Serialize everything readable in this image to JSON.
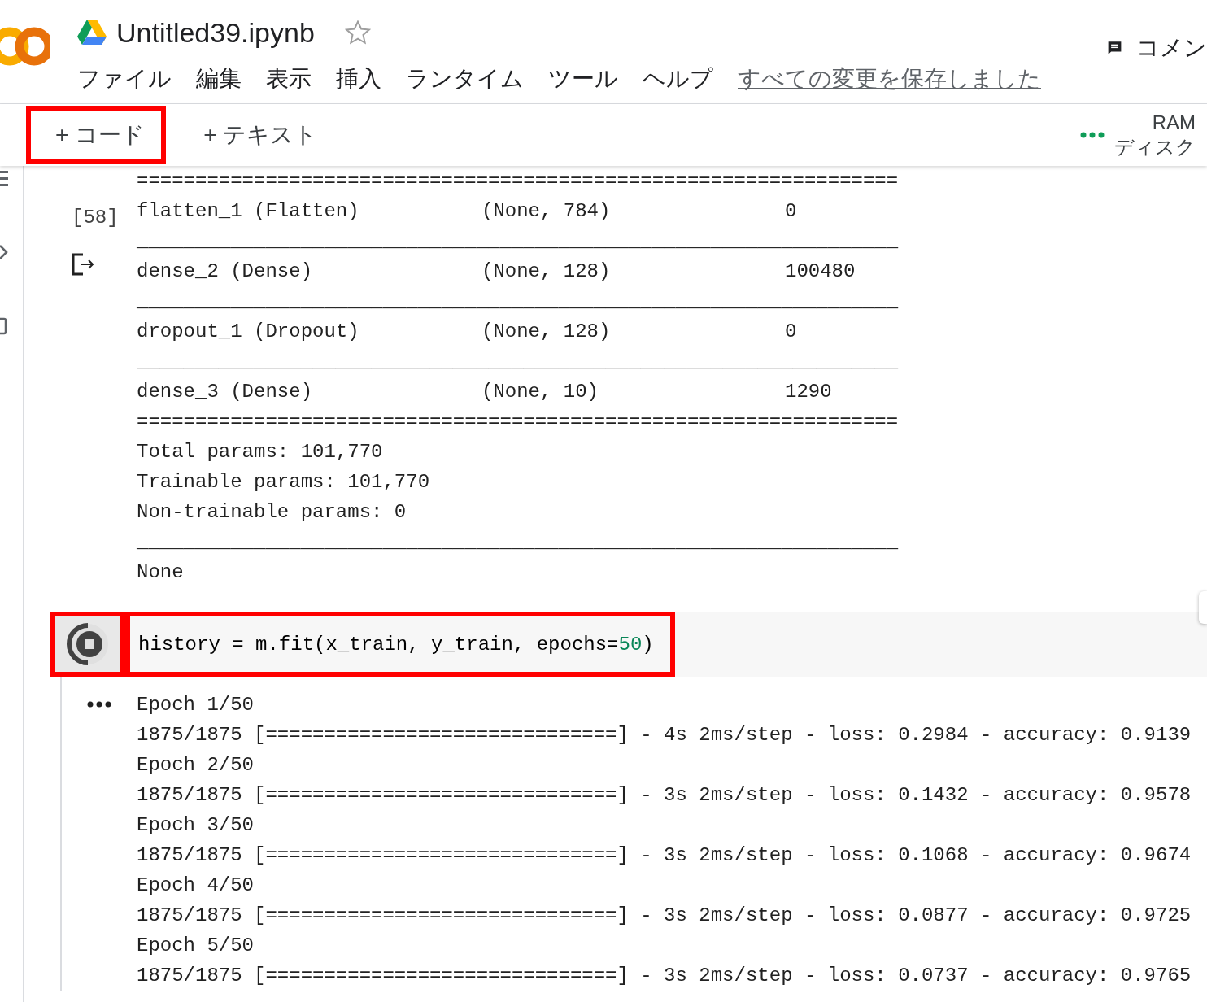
{
  "header": {
    "title": "Untitled39.ipynb",
    "starred": false,
    "menu": [
      "ファイル",
      "編集",
      "表示",
      "挿入",
      "ランタイム",
      "ツール",
      "ヘルプ"
    ],
    "save_status": "すべての変更を保存しました",
    "comment_button": "コメン"
  },
  "toolbar": {
    "buttons": [
      {
        "label": "+ コード",
        "highlighted": true
      },
      {
        "label": "+ テキスト",
        "highlighted": false
      }
    ],
    "resources": {
      "ram": "RAM",
      "disk": "ディスク"
    }
  },
  "summary_cell": {
    "execution_count": "[58]",
    "lines": [
      {
        "kind": "rule",
        "text": "================================================================="
      },
      {
        "kind": "row",
        "cells": [
          "flatten_1 (Flatten)",
          "(None, 784)",
          "0"
        ]
      },
      {
        "kind": "rule",
        "text": "_________________________________________________________________"
      },
      {
        "kind": "row",
        "cells": [
          "dense_2 (Dense)",
          "(None, 128)",
          "100480"
        ]
      },
      {
        "kind": "rule",
        "text": "_________________________________________________________________"
      },
      {
        "kind": "row",
        "cells": [
          "dropout_1 (Dropout)",
          "(None, 128)",
          "0"
        ]
      },
      {
        "kind": "rule",
        "text": "_________________________________________________________________"
      },
      {
        "kind": "row",
        "cells": [
          "dense_3 (Dense)",
          "(None, 10)",
          "1290"
        ]
      },
      {
        "kind": "rule",
        "text": "================================================================="
      },
      {
        "kind": "text",
        "text": "Total params: 101,770"
      },
      {
        "kind": "text",
        "text": "Trainable params: 101,770"
      },
      {
        "kind": "text",
        "text": "Non-trainable params: 0"
      },
      {
        "kind": "rule",
        "text": "_________________________________________________________________"
      },
      {
        "kind": "text",
        "text": "None"
      }
    ]
  },
  "running_cell": {
    "running": true,
    "run_button_highlighted": true,
    "code_highlighted": true,
    "code": [
      {
        "kind": "plain",
        "text": "history = m.fit(x_train, y_train, epochs="
      },
      {
        "kind": "number",
        "text": "50"
      },
      {
        "kind": "plain",
        "text": ")"
      }
    ],
    "output": [
      "Epoch 1/50",
      "1875/1875 [==============================] - 4s 2ms/step - loss: 0.2984 - accuracy: 0.9139",
      "Epoch 2/50",
      "1875/1875 [==============================] - 3s 2ms/step - loss: 0.1432 - accuracy: 0.9578",
      "Epoch 3/50",
      "1875/1875 [==============================] - 3s 2ms/step - loss: 0.1068 - accuracy: 0.9674",
      "Epoch 4/50",
      "1875/1875 [==============================] - 3s 2ms/step - loss: 0.0877 - accuracy: 0.9725",
      "Epoch 5/50",
      "1875/1875 [==============================] - 3s 2ms/step - loss: 0.0737 - accuracy: 0.9765"
    ]
  }
}
